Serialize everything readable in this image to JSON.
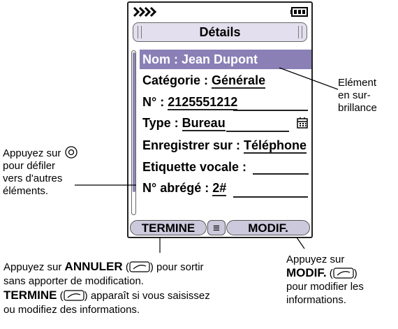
{
  "screen": {
    "title": "Détails",
    "rows": [
      {
        "label": "Nom : Jean Dupont",
        "value": ""
      },
      {
        "label": "Catégorie : ",
        "value": "Générale"
      },
      {
        "label": "N° : ",
        "value": "2125551212"
      },
      {
        "label": "Type : ",
        "value": "Bureau"
      },
      {
        "label": "Enregistrer sur : ",
        "value": "Téléphone"
      },
      {
        "label": "Etiquette vocale : ",
        "value": ""
      },
      {
        "label": "N° abrégé : ",
        "value": "2#"
      }
    ],
    "softkeys": {
      "left": "TERMINE",
      "center": "≡",
      "right": "MODIF."
    }
  },
  "annotations": {
    "highlight": [
      "Elément",
      "en sur-",
      "brillance"
    ],
    "scroll": [
      "Appuyez sur",
      "pour défiler",
      "vers d'autres",
      "éléments."
    ],
    "bottom_left": {
      "l1_pre": "Appuyez sur ",
      "l1_key": "ANNULER",
      "l1_post": " pour sortir",
      "l2": "sans apporter de modification.",
      "l3_key": "TERMINE",
      "l3_post": " apparaît si vous saisissez",
      "l4": "ou modifiez des informations."
    },
    "bottom_right": {
      "l1": "Appuyez sur",
      "l2_key": "MODIF.",
      "l3": "pour modifier les",
      "l4": "informations."
    }
  },
  "colors": {
    "highlight": "#8a80b6",
    "softkey": "#ccc9dc",
    "titlebar": "#e3dfee"
  }
}
